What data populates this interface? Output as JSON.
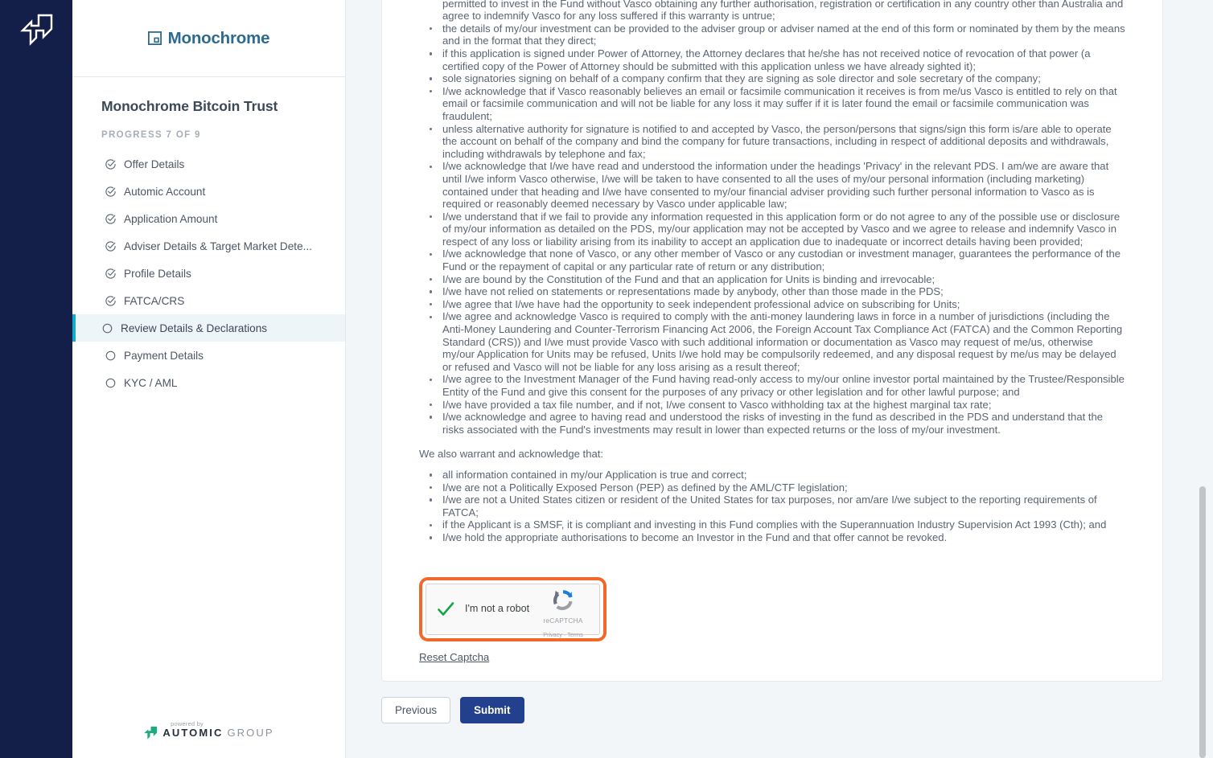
{
  "rail": {
    "logo_icon": "automic-glyph-icon"
  },
  "sidebar": {
    "brand": {
      "icon": "monochrome-square-icon",
      "name": "Monochrome"
    },
    "fund_title": "Monochrome Bitcoin Trust",
    "progress_label": "PROGRESS 7 OF 9",
    "steps": [
      {
        "label": "Offer Details",
        "state": "complete",
        "icon": "circle-check-icon"
      },
      {
        "label": "Automic Account",
        "state": "complete",
        "icon": "circle-check-icon"
      },
      {
        "label": "Application Amount",
        "state": "complete",
        "icon": "circle-check-icon"
      },
      {
        "label": "Adviser Details & Target Market Dete...",
        "state": "complete",
        "icon": "circle-check-icon"
      },
      {
        "label": "Profile Details",
        "state": "complete",
        "icon": "circle-check-icon"
      },
      {
        "label": "FATCA/CRS",
        "state": "complete",
        "icon": "circle-check-icon"
      },
      {
        "label": "Review Details & Declarations",
        "state": "active",
        "icon": "circle-empty-icon"
      },
      {
        "label": "Payment Details",
        "state": "pending",
        "icon": "circle-empty-icon"
      },
      {
        "label": "KYC / AML",
        "state": "pending",
        "icon": "circle-empty-icon"
      }
    ],
    "footer": {
      "powered_by": "powered by",
      "automic_bold": "AUTOMIC",
      "automic_light": "GROUP",
      "icon": "automic-group-logo-icon"
    }
  },
  "declarations": {
    "intro_partial": "I/we have received and accepted this invitation to subscribe for Units in the Fund in Australia and represent and warrant to Vasco that I/we are permitted to invest in the Fund without Vasco obtaining any further authorisation, registration or certification in any country other than Australia and agree to indemnify Vasco for any loss suffered if this warranty is untrue;",
    "bullets": [
      "the details of my/our investment can be provided to the adviser group or adviser named at the end of this form or nominated by them by the means and in the format that they direct;",
      "if this application is signed under Power of Attorney, the Attorney declares that he/she has not received notice of revocation of that power (a certified copy of the Power of Attorney should be submitted with this application unless we have already sighted it);",
      "sole signatories signing on behalf of a company confirm that they are signing as sole director and sole secretary of the company;",
      "I/we acknowledge that if Vasco reasonably believes an email or facsimile communication it receives is from me/us Vasco is entitled to rely on that email or facsimile communication and will not be liable for any loss it may suffer if it is later found the email or facsimile communication was fraudulent;",
      "unless alternative authority for signature is notified to and accepted by Vasco, the person/persons that signs/sign this form is/are able to operate the account on behalf of the company and bind the company for future transactions, including in respect of additional deposits and withdrawals, including withdrawals by telephone and fax;",
      "I/we acknowledge that I/we have read and understood the information under the headings 'Privacy' in the relevant PDS. I am/we are aware that until I/we inform Vasco otherwise, I/we will be taken to have consented to all the uses of my/our personal information (including marketing) contained under that heading and I/we have consented to my/our financial adviser providing such further personal information to Vasco as is required or reasonably deemed necessary by Vasco under applicable law;",
      "I/we understand that if we fail to provide any information requested in this application form or do not agree to any of the possible use or disclosure of my/our information as detailed on the PDS, my/our application may not be accepted by Vasco and we agree to release and indemnify Vasco in respect of any loss or liability arising from its inability to accept an application due to inadequate or incorrect details having been provided;",
      "I/we acknowledge that none of Vasco, or any other member of Vasco or any custodian or investment manager, guarantees the performance of the Fund or the repayment of capital or any particular rate of return or any distribution;",
      "I/we are bound by the Constitution of the Fund and that an application for Units is binding and irrevocable;",
      "I/we have not relied on statements or representations made by anybody, other than those made in the PDS;",
      "I/we agree that I/we have had the opportunity to seek independent professional advice on subscribing for Units;",
      "I/we agree and acknowledge Vasco is required to comply with the anti-money laundering laws in force in a number of jurisdictions (including the Anti-Money Laundering and Counter-Terrorism Financing Act 2006, the Foreign Account Tax Compliance Act (FATCA) and the Common Reporting Standard (CRS)) and I/we must provide Vasco with such additional information or documentation as Vasco may request of me/us, otherwise my/our Application for Units may be refused, Units I/we hold may be compulsorily redeemed, and any disposal request by me/us may be delayed or refused and Vasco will not be liable for any loss arising as a result thereof;",
      "I/we agree to the Investment Manager of the Fund having read-only access to my/our online investor portal maintained by the Trustee/Responsible Entity of the Fund and give this consent for the purposes of any privacy or other legislation and for other lawful purpose; and",
      "I/we have provided a tax file number, and if not, I/we consent to Vasco withholding tax at the highest marginal tax rate;",
      "I/we acknowledge and agree to having read and understood the risks of investing in the fund as described in the PDS and understand that the risks associated with the Fund's investments may result in lower than expected returns or the loss of my/our investment."
    ],
    "warrant_heading": "We also warrant and acknowledge that:",
    "warrant_bullets": [
      "all information contained in my/our Application is true and correct;",
      "I/we are not a Politically Exposed Person (PEP) as defined by the AML/CTF legislation;",
      "I/we are not a United States citizen or resident of the United States for tax purposes, nor am/are I/we subject to the reporting requirements of FATCA;",
      "if the Applicant is a SMSF, it is compliant and investing in this Fund complies with the Superannuation Industry Supervision Act 1993 (Cth); and",
      "I/we hold the appropriate authorisations to become an Investor in the Fund and that offer cannot be revoked."
    ]
  },
  "captcha": {
    "label": "I'm not a robot",
    "checked": true,
    "brand_name": "reCAPTCHA",
    "privacy": "Privacy",
    "separator": "·",
    "terms": "Terms",
    "reset_link": "Reset Captcha",
    "highlight_color": "#f2682a"
  },
  "footer_actions": {
    "previous_label": "Previous",
    "submit_label": "Submit",
    "submit_color": "#23408e"
  },
  "scrollbar": {
    "present": true
  }
}
